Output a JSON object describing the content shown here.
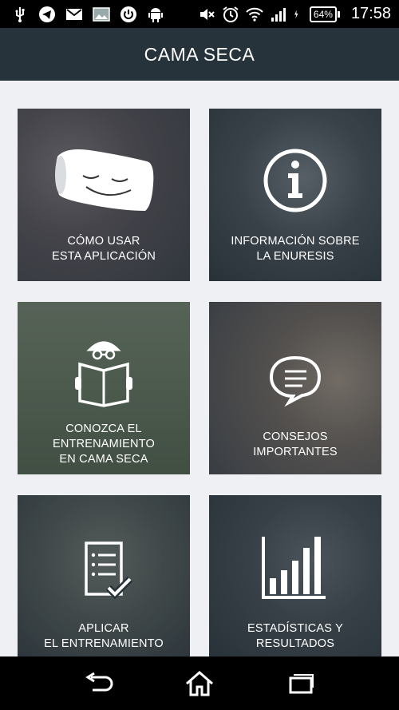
{
  "status_bar": {
    "battery": "64%",
    "time": "17:58",
    "left_icons": [
      "usb-icon",
      "telegram-icon",
      "gmail-icon",
      "image-icon",
      "power-icon",
      "android-icon"
    ],
    "right_icons": [
      "mute-icon",
      "alarm-icon",
      "wifi-icon",
      "signal-icon",
      "charging-icon"
    ]
  },
  "app_bar": {
    "title": "CAMA SECA"
  },
  "tiles": [
    {
      "line1": "CÓMO USAR",
      "line2": "ESTA APLICACIÓN",
      "line3": "",
      "icon": "pillow-icon"
    },
    {
      "line1": "INFORMACIÓN SOBRE",
      "line2": "LA ENURESIS",
      "line3": "",
      "icon": "info-icon"
    },
    {
      "line1": "CONOZCA EL",
      "line2": "ENTRENAMIENTO",
      "line3": "EN CAMA SECA",
      "icon": "reader-icon"
    },
    {
      "line1": "CONSEJOS",
      "line2": "IMPORTANTES",
      "line3": "",
      "icon": "chat-bubble-icon"
    },
    {
      "line1": "APLICAR",
      "line2": "EL ENTRENAMIENTO",
      "line3": "",
      "icon": "checklist-icon"
    },
    {
      "line1": "ESTADÍSTICAS Y",
      "line2": "RESULTADOS",
      "line3": "",
      "icon": "bar-chart-icon"
    }
  ],
  "colors": {
    "app_bar": "#26333b",
    "background": "#eef0f3",
    "tile_overlay": "#26333b"
  },
  "nav_bar": {
    "buttons": [
      "back-icon",
      "home-icon",
      "recent-apps-icon"
    ]
  }
}
